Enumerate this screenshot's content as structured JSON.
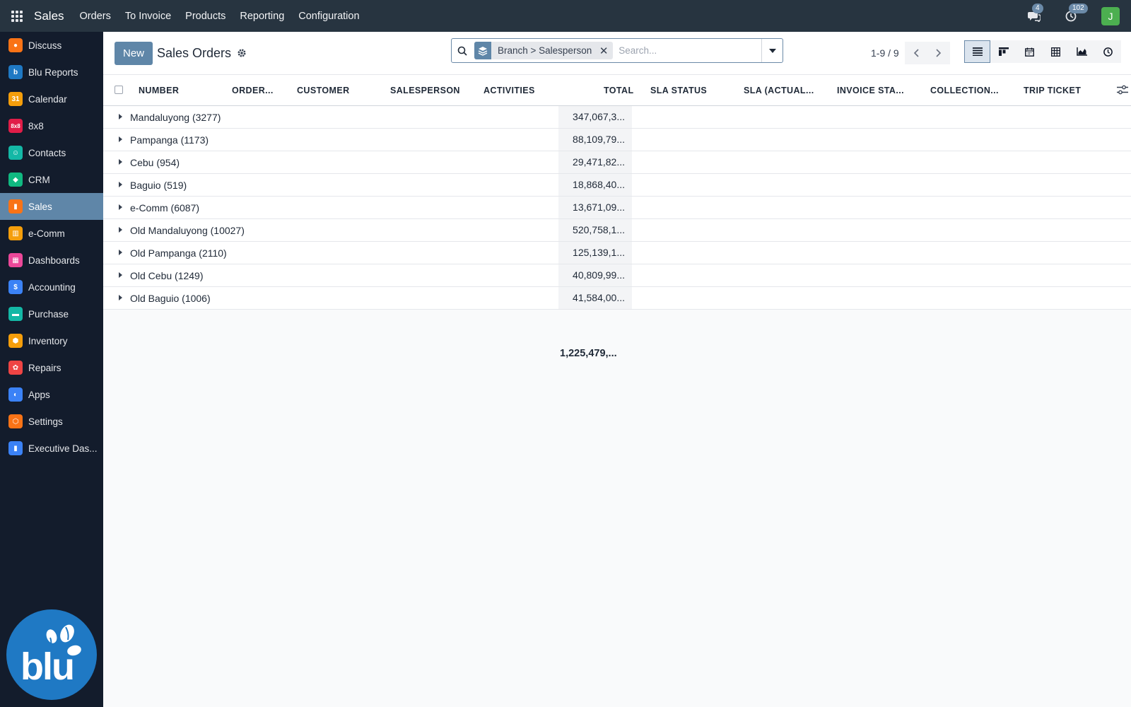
{
  "topbar": {
    "app_name": "Sales",
    "menu": [
      "Orders",
      "To Invoice",
      "Products",
      "Reporting",
      "Configuration"
    ],
    "messages_badge": "4",
    "activities_badge": "102",
    "avatar_letter": "J"
  },
  "sidebar": {
    "items": [
      {
        "label": "Discuss",
        "icon": "discuss-icon",
        "color": "#f97316"
      },
      {
        "label": "Blu Reports",
        "icon": "blu-reports-icon",
        "color": "#1f79c4"
      },
      {
        "label": "Calendar",
        "icon": "calendar-icon",
        "color": "#f59e0b"
      },
      {
        "label": "8x8",
        "icon": "eight-by-eight-icon",
        "color": "#e11d48"
      },
      {
        "label": "Contacts",
        "icon": "contacts-icon",
        "color": "#14b8a6"
      },
      {
        "label": "CRM",
        "icon": "crm-icon",
        "color": "#10b981"
      },
      {
        "label": "Sales",
        "icon": "sales-icon",
        "color": "#f97316"
      },
      {
        "label": "e-Comm",
        "icon": "ecomm-icon",
        "color": "#f59e0b"
      },
      {
        "label": "Dashboards",
        "icon": "dashboards-icon",
        "color": "#ec4899"
      },
      {
        "label": "Accounting",
        "icon": "accounting-icon",
        "color": "#3b82f6"
      },
      {
        "label": "Purchase",
        "icon": "purchase-icon",
        "color": "#14b8a6"
      },
      {
        "label": "Inventory",
        "icon": "inventory-icon",
        "color": "#f59e0b"
      },
      {
        "label": "Repairs",
        "icon": "repairs-icon",
        "color": "#ef4444"
      },
      {
        "label": "Apps",
        "icon": "apps-store-icon",
        "color": "#3b82f6"
      },
      {
        "label": "Settings",
        "icon": "settings-icon",
        "color": "#f97316"
      },
      {
        "label": "Executive Das...",
        "icon": "executive-dashboard-icon",
        "color": "#3b82f6"
      }
    ],
    "active_index": 6,
    "logo_text": "blu"
  },
  "control": {
    "new_label": "New",
    "title": "Sales Orders",
    "facet_label": "Branch > Salesperson",
    "search_placeholder": "Search...",
    "pager_value": "1-9 / 9"
  },
  "list": {
    "columns": [
      "NUMBER",
      "ORDER...",
      "CUSTOMER",
      "SALESPERSON",
      "ACTIVITIES",
      "TOTAL",
      "SLA STATUS",
      "SLA (ACTUAL...",
      "INVOICE STA...",
      "COLLECTION...",
      "TRIP TICKET"
    ],
    "groups": [
      {
        "name": "Mandaluyong (3277)",
        "total": "347,067,3..."
      },
      {
        "name": "Pampanga (1173)",
        "total": "88,109,79..."
      },
      {
        "name": "Cebu (954)",
        "total": "29,471,82..."
      },
      {
        "name": "Baguio (519)",
        "total": "18,868,40..."
      },
      {
        "name": "e-Comm (6087)",
        "total": "13,671,09..."
      },
      {
        "name": "Old Mandaluyong (10027)",
        "total": "520,758,1..."
      },
      {
        "name": "Old Pampanga (2110)",
        "total": "125,139,1..."
      },
      {
        "name": "Old Cebu (1249)",
        "total": "40,809,99..."
      },
      {
        "name": "Old Baguio (1006)",
        "total": "41,584,00..."
      }
    ],
    "grand_total": "1,225,479,..."
  }
}
